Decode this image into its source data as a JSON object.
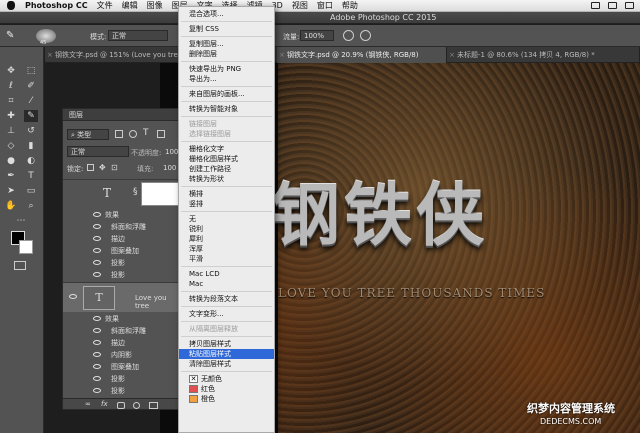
{
  "menubar": {
    "app": "Photoshop CC",
    "items": [
      "文件",
      "编辑",
      "图像",
      "图层",
      "文字",
      "选择",
      "滤镜",
      "3D",
      "视图",
      "窗口",
      "帮助"
    ]
  },
  "titlebar": {
    "title": "Adobe Photoshop CC 2015"
  },
  "options": {
    "mode_label": "模式:",
    "mode_value": "正常",
    "flow_label": "流量:",
    "flow_value": "100%",
    "brush_size": "45"
  },
  "tabs": [
    {
      "label": "钢铁文字.psd @ 151% (Love you tree thousands times, RGB/8)",
      "active": false
    },
    {
      "label": "钢铁文字.psd @ 20.9% (钢铁侠, RGB/8)",
      "active": true
    },
    {
      "label": "未标题-1 @ 80.6% (134 拷贝 4, RGB/8) *",
      "active": false
    }
  ],
  "layers": {
    "title": "图层",
    "filter": "类型",
    "blend": "正常",
    "opacity_label": "不透明度:",
    "opacity": "100",
    "lock_label": "锁定:",
    "fill_label": "填充:",
    "fill": "100",
    "effects_label": "效果",
    "layer2_name": "Love you tree",
    "layer1_effects": [
      "斜面和浮雕",
      "描边",
      "图案叠加",
      "投影",
      "投影"
    ],
    "layer2_effects": [
      "斜面和浮雕",
      "描边",
      "内阴影",
      "图案叠加",
      "投影",
      "投影"
    ]
  },
  "context_menu": [
    {
      "label": "混合选项...",
      "state": "normal"
    },
    {
      "sep": true
    },
    {
      "label": "复制 CSS",
      "state": "normal"
    },
    {
      "sep": true
    },
    {
      "label": "复制图层...",
      "state": "normal"
    },
    {
      "label": "删除图层",
      "state": "normal"
    },
    {
      "sep": true
    },
    {
      "label": "快速导出为 PNG",
      "state": "normal"
    },
    {
      "label": "导出为...",
      "state": "normal"
    },
    {
      "sep": true
    },
    {
      "label": "来自图层的画板...",
      "state": "normal"
    },
    {
      "sep": true
    },
    {
      "label": "转换为智能对象",
      "state": "normal"
    },
    {
      "sep": true
    },
    {
      "label": "链接图层",
      "state": "disabled"
    },
    {
      "label": "选择链接图层",
      "state": "disabled"
    },
    {
      "sep": true
    },
    {
      "label": "栅格化文字",
      "state": "normal"
    },
    {
      "label": "栅格化图层样式",
      "state": "normal"
    },
    {
      "label": "创建工作路径",
      "state": "normal"
    },
    {
      "label": "转换为形状",
      "state": "normal"
    },
    {
      "sep": true
    },
    {
      "label": "横排",
      "state": "normal"
    },
    {
      "label": "竖排",
      "state": "normal"
    },
    {
      "sep": true
    },
    {
      "label": "无",
      "state": "normal"
    },
    {
      "label": "锐利",
      "state": "normal"
    },
    {
      "label": "犀利",
      "state": "normal"
    },
    {
      "label": "浑厚",
      "state": "normal"
    },
    {
      "label": "平滑",
      "state": "normal"
    },
    {
      "sep": true
    },
    {
      "label": "Mac LCD",
      "state": "normal"
    },
    {
      "label": "Mac",
      "state": "normal"
    },
    {
      "sep": true
    },
    {
      "label": "转换为段落文本",
      "state": "normal"
    },
    {
      "sep": true
    },
    {
      "label": "文字变形...",
      "state": "normal"
    },
    {
      "sep": true
    },
    {
      "label": "从隔离图层释放",
      "state": "disabled"
    },
    {
      "sep": true
    },
    {
      "label": "拷贝图层样式",
      "state": "normal"
    },
    {
      "label": "粘贴图层样式",
      "state": "selected"
    },
    {
      "label": "清除图层样式",
      "state": "normal"
    },
    {
      "sep": true
    },
    {
      "label": "无颜色",
      "state": "normal",
      "swatch": "none"
    },
    {
      "label": "红色",
      "state": "normal",
      "swatch": "#e05050"
    },
    {
      "label": "橙色",
      "state": "normal",
      "swatch": "#f0a040"
    }
  ],
  "canvas": {
    "big_text": "钢铁侠",
    "sub_text": "LOVE YOU TREE THOUSANDS TIMES"
  },
  "watermark": {
    "line1": "织梦内容管理系统",
    "line2": "DEDECMS.COM"
  }
}
